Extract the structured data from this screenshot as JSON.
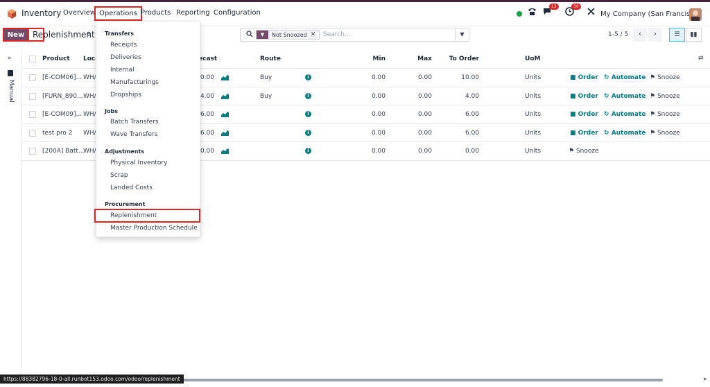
{
  "app": {
    "title": "Inventory",
    "menu": [
      "Overview",
      "Operations",
      "Products",
      "Reporting",
      "Configuration"
    ],
    "company": "My Company (San Francisco)",
    "badges": {
      "messages": "13",
      "activities": "30"
    }
  },
  "control": {
    "new_label": "New",
    "title": "Replenishment",
    "filter_facet": "Not Snoozed",
    "search_placeholder": "Search...",
    "pager": "1-5 / 5"
  },
  "sidebar": {
    "label": "Manual"
  },
  "columns": [
    "Product",
    "Loca",
    "ecast",
    "Route",
    "Min",
    "Max",
    "To Order",
    "UoM"
  ],
  "rows": [
    {
      "product": "[E-COM06]...",
      "location": "WH/",
      "forecast": "10.00",
      "route": "Buy",
      "min": "0.00",
      "max": "0.00",
      "to_order": "10.00",
      "uom": "Units",
      "actions": [
        "Order",
        "Automate",
        "Snooze"
      ]
    },
    {
      "product": "[FURN_890...",
      "location": "WH/",
      "forecast": "-4.00",
      "route": "Buy",
      "min": "0.00",
      "max": "0.00",
      "to_order": "4.00",
      "uom": "Units",
      "actions": [
        "Order",
        "Automate",
        "Snooze"
      ]
    },
    {
      "product": "[E-COM09]...",
      "location": "WH/",
      "forecast": "-6.00",
      "route": "",
      "min": "0.00",
      "max": "0.00",
      "to_order": "6.00",
      "uom": "Units",
      "actions": [
        "Order",
        "Automate",
        "Snooze"
      ]
    },
    {
      "product": "test pro 2",
      "location": "WH/",
      "forecast": "-6.00",
      "route": "",
      "min": "0.00",
      "max": "0.00",
      "to_order": "6.00",
      "uom": "Units",
      "actions": [
        "Order",
        "Automate",
        "Snooze"
      ]
    },
    {
      "product": "[200A] Batt...",
      "location": "WH/",
      "forecast": "10.00",
      "route": "",
      "min": "0.00",
      "max": "0.00",
      "to_order": "0.00",
      "uom": "Units",
      "actions": [
        "Snooze"
      ]
    }
  ],
  "dropdown": {
    "sections": [
      {
        "header": "Transfers",
        "items": [
          "Receipts",
          "Deliveries",
          "Internal",
          "Manufacturings",
          "Dropships"
        ]
      },
      {
        "header": "Jobs",
        "items": [
          "Batch Transfers",
          "Wave Transfers"
        ]
      },
      {
        "header": "Adjustments",
        "items": [
          "Physical Inventory",
          "Scrap",
          "Landed Costs"
        ]
      },
      {
        "header": "Procurement",
        "items": [
          "Replenishment",
          "Master Production Schedule"
        ]
      }
    ]
  },
  "status_url": "https://88382796-18-0-all.runbot153.odoo.com/odoo/replenishment",
  "colors": {
    "brand": "#714b67",
    "accent": "#017e84",
    "highlight": "#dc2626"
  }
}
